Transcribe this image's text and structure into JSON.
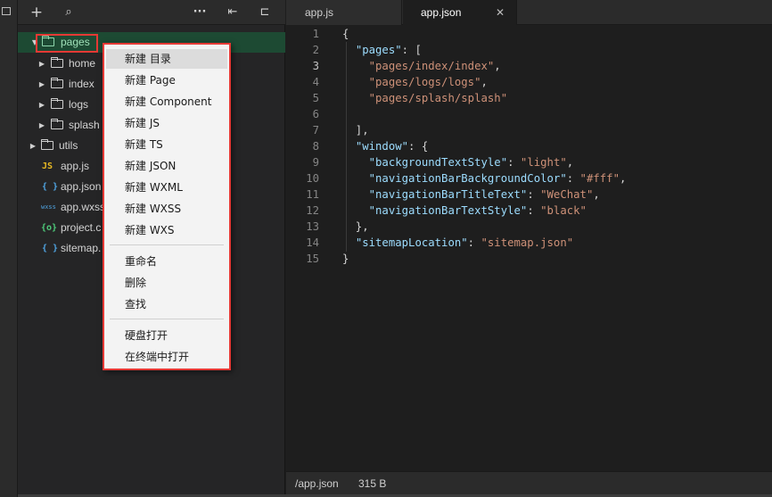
{
  "activity": {
    "icon": "panel-icon"
  },
  "toolbar": {
    "add": "+",
    "search": "⌕",
    "more": "···",
    "collapse": "⇤",
    "split": "⊏"
  },
  "tree": [
    {
      "name": "pages",
      "kind": "folder",
      "open": true,
      "selected": true
    },
    {
      "name": "home",
      "kind": "folder"
    },
    {
      "name": "index",
      "kind": "folder"
    },
    {
      "name": "logs",
      "kind": "folder"
    },
    {
      "name": "splash",
      "kind": "folder"
    },
    {
      "name": "utils",
      "kind": "folder"
    },
    {
      "name": "app.js",
      "kind": "js",
      "icon": "JS",
      "color": "#e8b923"
    },
    {
      "name": "app.json",
      "kind": "json",
      "icon": "{ }",
      "color": "#4fa3e0"
    },
    {
      "name": "app.wxss",
      "kind": "wxss",
      "icon": "wxss",
      "color": "#4fa3e0"
    },
    {
      "name": "project.c",
      "kind": "config",
      "icon": "{o}",
      "color": "#4ec97a"
    },
    {
      "name": "sitemap.",
      "kind": "json",
      "icon": "{ }",
      "color": "#4fa3e0"
    }
  ],
  "context_menu": {
    "items": [
      {
        "label": "新建 目录",
        "hover": true
      },
      {
        "label": "新建 Page"
      },
      {
        "label": "新建 Component"
      },
      {
        "label": "新建 JS"
      },
      {
        "label": "新建 TS"
      },
      {
        "label": "新建 JSON"
      },
      {
        "label": "新建 WXML"
      },
      {
        "label": "新建 WXSS"
      },
      {
        "label": "新建 WXS"
      },
      {
        "separator": true
      },
      {
        "label": "重命名"
      },
      {
        "label": "删除"
      },
      {
        "label": "查找"
      },
      {
        "separator": true
      },
      {
        "label": "硬盘打开"
      },
      {
        "label": "在终端中打开"
      }
    ]
  },
  "tabs": {
    "appjs": "app.js",
    "appjson": "app.json",
    "close": "✕"
  },
  "editor": {
    "current_line": 3,
    "lines": [
      [
        [
          "p",
          "{"
        ]
      ],
      [
        [
          "p",
          "  "
        ],
        [
          "k",
          "\"pages\""
        ],
        [
          "p",
          ": ["
        ]
      ],
      [
        [
          "p",
          "    "
        ],
        [
          "s",
          "\"pages/index/index\""
        ],
        [
          "p",
          ","
        ]
      ],
      [
        [
          "p",
          "    "
        ],
        [
          "s",
          "\"pages/logs/logs\""
        ],
        [
          "p",
          ","
        ]
      ],
      [
        [
          "p",
          "    "
        ],
        [
          "s",
          "\"pages/splash/splash\""
        ]
      ],
      [],
      [
        [
          "p",
          "  ],"
        ]
      ],
      [
        [
          "p",
          "  "
        ],
        [
          "k",
          "\"window\""
        ],
        [
          "p",
          ": {"
        ]
      ],
      [
        [
          "p",
          "    "
        ],
        [
          "k",
          "\"backgroundTextStyle\""
        ],
        [
          "p",
          ": "
        ],
        [
          "s",
          "\"light\""
        ],
        [
          "p",
          ","
        ]
      ],
      [
        [
          "p",
          "    "
        ],
        [
          "k",
          "\"navigationBarBackgroundColor\""
        ],
        [
          "p",
          ": "
        ],
        [
          "s",
          "\"#fff\""
        ],
        [
          "p",
          ","
        ]
      ],
      [
        [
          "p",
          "    "
        ],
        [
          "k",
          "\"navigationBarTitleText\""
        ],
        [
          "p",
          ": "
        ],
        [
          "s",
          "\"WeChat\""
        ],
        [
          "p",
          ","
        ]
      ],
      [
        [
          "p",
          "    "
        ],
        [
          "k",
          "\"navigationBarTextStyle\""
        ],
        [
          "p",
          ": "
        ],
        [
          "s",
          "\"black\""
        ]
      ],
      [
        [
          "p",
          "  },"
        ]
      ],
      [
        [
          "p",
          "  "
        ],
        [
          "k",
          "\"sitemapLocation\""
        ],
        [
          "p",
          ": "
        ],
        [
          "s",
          "\"sitemap.json\""
        ]
      ],
      [
        [
          "p",
          "}"
        ]
      ]
    ]
  },
  "status": {
    "path": "/app.json",
    "size": "315 B"
  },
  "colors": {
    "accent_red": "#e53935",
    "selection": "#1d4a33"
  }
}
